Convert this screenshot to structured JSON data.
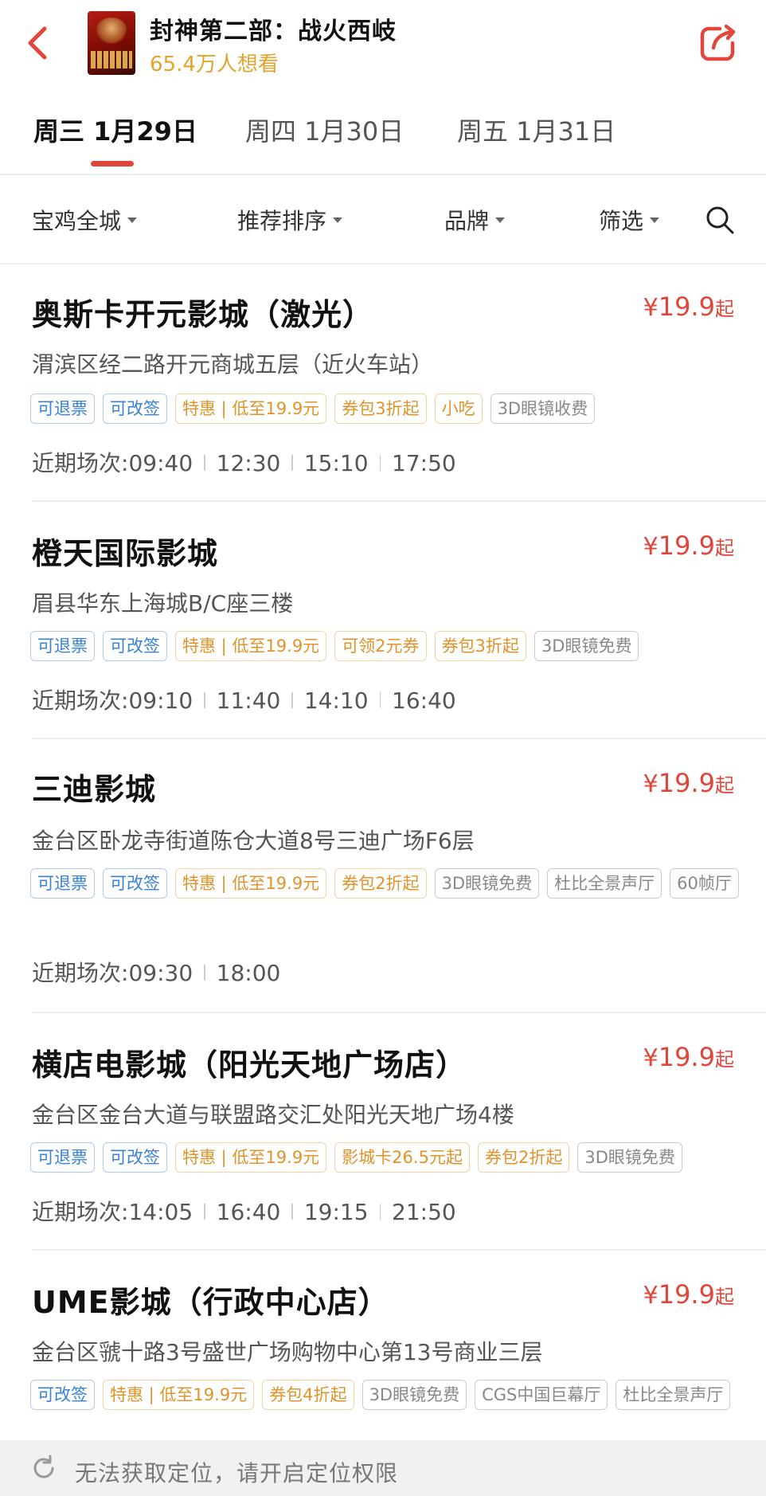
{
  "header": {
    "back_icon": "chevron-left-icon",
    "movie_title": "封神第二部：战火西岐",
    "want_count": "65.4万人想看",
    "share_icon": "share-icon",
    "accent": "#e0463b",
    "want_color": "#e2a52c"
  },
  "date_tabs": [
    {
      "label": "周三 1月29日",
      "active": true
    },
    {
      "label": "周四 1月30日",
      "active": false
    },
    {
      "label": "周五 1月31日",
      "active": false
    }
  ],
  "filters": [
    {
      "label": "宝鸡全城"
    },
    {
      "label": "推荐排序"
    },
    {
      "label": "品牌"
    },
    {
      "label": "筛选"
    }
  ],
  "search_icon": "search-icon",
  "cinemas": [
    {
      "name": "奥斯卡开元影城（激光）",
      "price": {
        "yen": "¥",
        "amount": "19.9",
        "suffix": "起"
      },
      "address": "渭滨区经二路开元商城五层（近火车站）",
      "tags": [
        {
          "text": "可退票",
          "style": "blue"
        },
        {
          "text": "可改签",
          "style": "blue"
        },
        {
          "text": "特惠 | 低至19.9元",
          "style": "orange"
        },
        {
          "text": "券包3折起",
          "style": "orange"
        },
        {
          "text": "小吃",
          "style": "orange"
        },
        {
          "text": "3D眼镜收费",
          "style": "gray"
        }
      ],
      "shows_label": "近期场次:",
      "showtimes": [
        "09:40",
        "12:30",
        "15:10",
        "17:50"
      ]
    },
    {
      "name": "橙天国际影城",
      "price": {
        "yen": "¥",
        "amount": "19.9",
        "suffix": "起"
      },
      "address": "眉县华东上海城B/C座三楼",
      "tags": [
        {
          "text": "可退票",
          "style": "blue"
        },
        {
          "text": "可改签",
          "style": "blue"
        },
        {
          "text": "特惠 | 低至19.9元",
          "style": "orange"
        },
        {
          "text": "可领2元券",
          "style": "orange"
        },
        {
          "text": "券包3折起",
          "style": "orange"
        },
        {
          "text": "3D眼镜免费",
          "style": "gray"
        }
      ],
      "shows_label": "近期场次:",
      "showtimes": [
        "09:10",
        "11:40",
        "14:10",
        "16:40"
      ]
    },
    {
      "name": "三迪影城",
      "price": {
        "yen": "¥",
        "amount": "19.9",
        "suffix": "起"
      },
      "address": "金台区卧龙寺街道陈仓大道8号三迪广场F6层",
      "tags": [
        {
          "text": "可退票",
          "style": "blue"
        },
        {
          "text": "可改签",
          "style": "blue"
        },
        {
          "text": "特惠 | 低至19.9元",
          "style": "orange"
        },
        {
          "text": "券包2折起",
          "style": "orange"
        },
        {
          "text": "3D眼镜免费",
          "style": "gray"
        },
        {
          "text": "杜比全景声厅",
          "style": "gray"
        },
        {
          "text": "60帧厅",
          "style": "gray"
        }
      ],
      "shows_label": "近期场次:",
      "showtimes": [
        "09:30",
        "18:00"
      ]
    },
    {
      "name": "横店电影城（阳光天地广场店）",
      "price": {
        "yen": "¥",
        "amount": "19.9",
        "suffix": "起"
      },
      "address": "金台区金台大道与联盟路交汇处阳光天地广场4楼",
      "tags": [
        {
          "text": "可退票",
          "style": "blue"
        },
        {
          "text": "可改签",
          "style": "blue"
        },
        {
          "text": "特惠 | 低至19.9元",
          "style": "orange"
        },
        {
          "text": "影城卡26.5元起",
          "style": "orange"
        },
        {
          "text": "券包2折起",
          "style": "orange"
        },
        {
          "text": "3D眼镜免费",
          "style": "gray"
        }
      ],
      "shows_label": "近期场次:",
      "showtimes": [
        "14:05",
        "16:40",
        "19:15",
        "21:50"
      ]
    },
    {
      "name": "UME影城（行政中心店）",
      "price": {
        "yen": "¥",
        "amount": "19.9",
        "suffix": "起"
      },
      "address": "金台区虢十路3号盛世广场购物中心第13号商业三层",
      "tags": [
        {
          "text": "可改签",
          "style": "blue"
        },
        {
          "text": "特惠 | 低至19.9元",
          "style": "orange"
        },
        {
          "text": "券包4折起",
          "style": "orange"
        },
        {
          "text": "3D眼镜免费",
          "style": "gray"
        },
        {
          "text": "CGS中国巨幕厅",
          "style": "gray"
        },
        {
          "text": "杜比全景声厅",
          "style": "gray"
        }
      ],
      "shows_label": "",
      "showtimes": []
    }
  ],
  "toast": {
    "icon": "refresh-icon",
    "message": "无法获取定位，请开启定位权限"
  }
}
